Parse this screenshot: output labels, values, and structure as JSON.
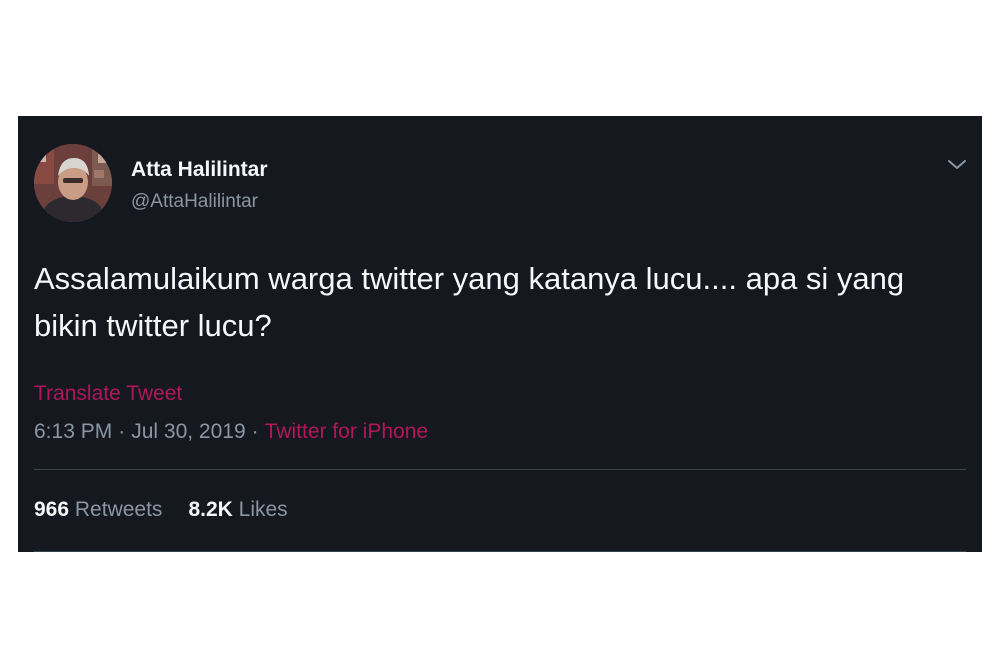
{
  "tweet": {
    "author": {
      "name": "Atta Halilintar",
      "handle": "@AttaHalilintar"
    },
    "text": "Assalamulaikum warga twitter yang katanya lucu.... apa si yang bikin twitter lucu?",
    "translate_label": "Translate Tweet",
    "time": "6:13 PM",
    "date": "Jul 30, 2019",
    "separator": "·",
    "source": "Twitter for iPhone",
    "stats": {
      "retweets_count": "966",
      "retweets_label": "Retweets",
      "likes_count": "8.2K",
      "likes_label": "Likes"
    }
  },
  "icons": {
    "menu": "chevron-down-icon",
    "avatar": "profile-avatar"
  },
  "colors": {
    "background": "#15181e",
    "text_primary": "#f5f8fa",
    "text_secondary": "#8a96a3",
    "accent": "#b0175b",
    "divider": "#38444d"
  }
}
